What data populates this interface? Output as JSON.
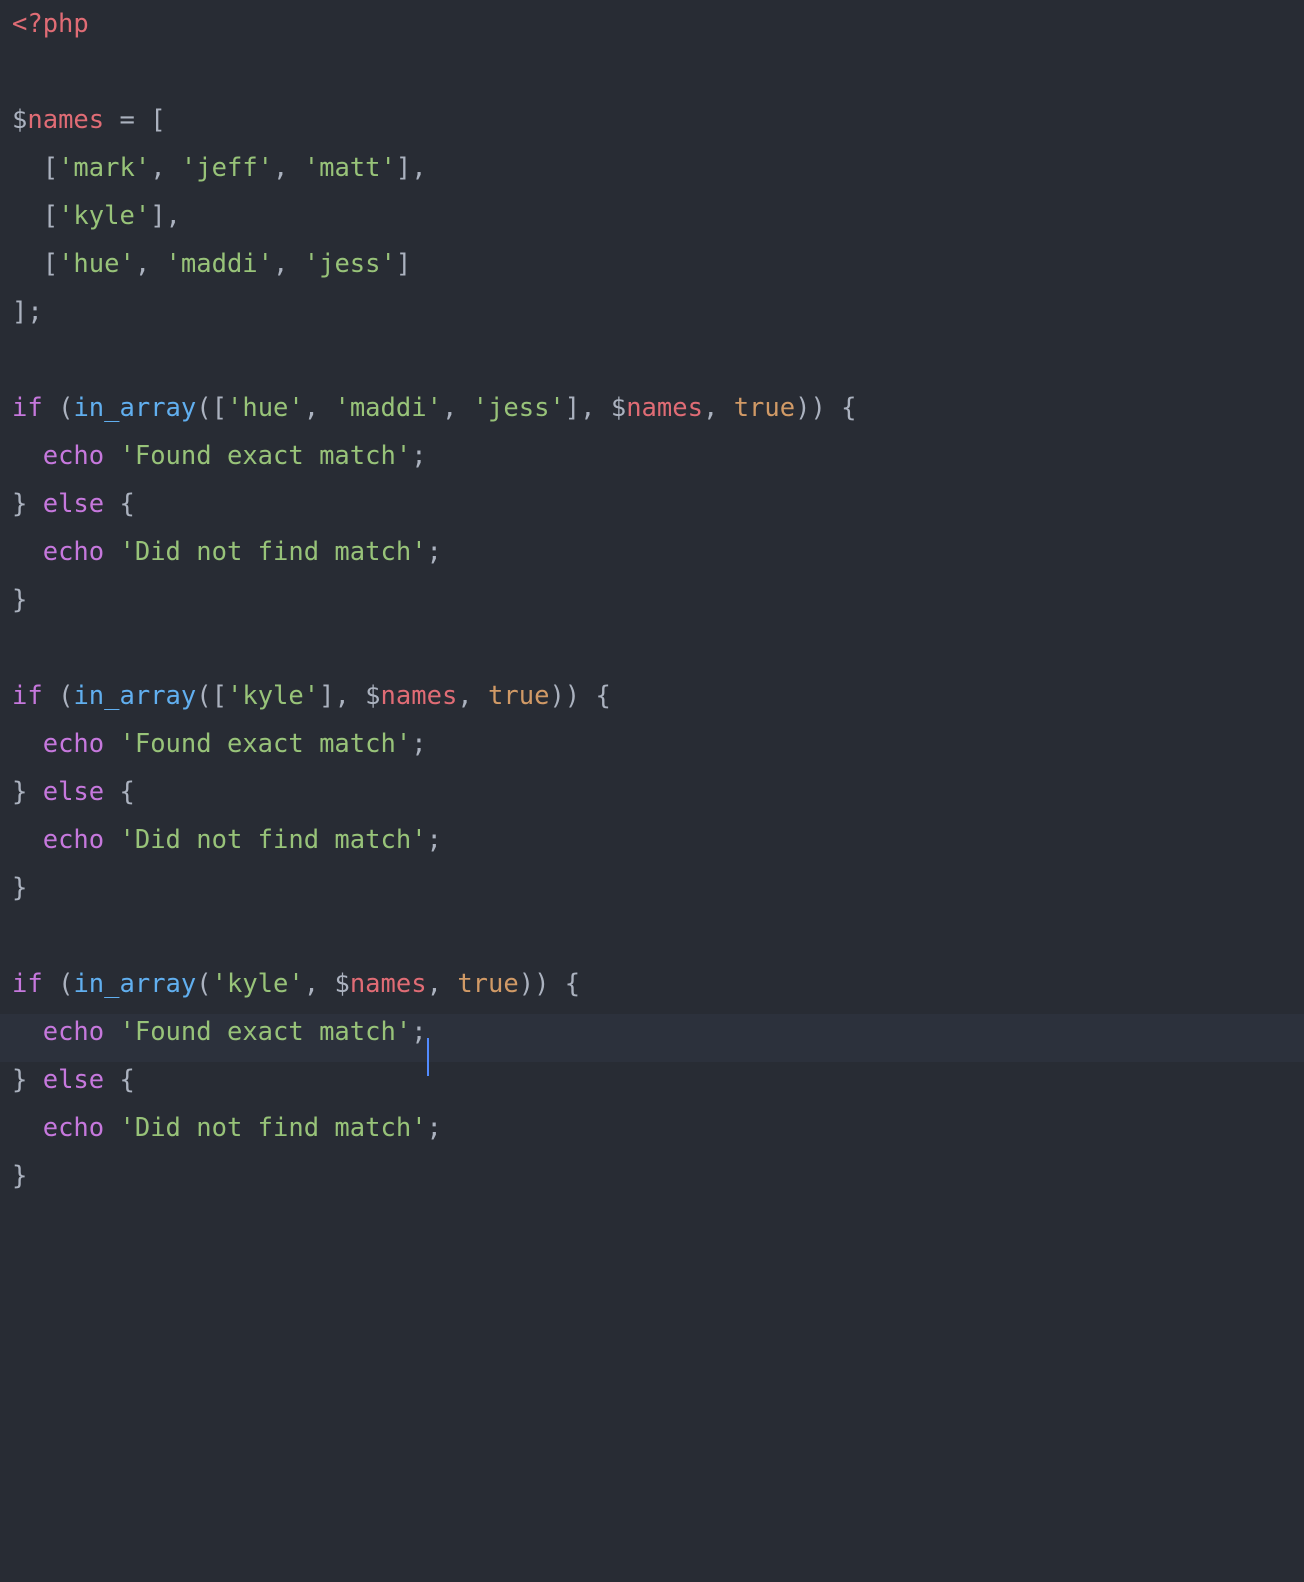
{
  "colors": {
    "background": "#282c34",
    "active_line_bg": "#2c313c",
    "cursor": "#528bff",
    "foreground": "#abb2bf",
    "keyword": "#c678dd",
    "string": "#98c379",
    "variable": "#e06c75",
    "function": "#61afef",
    "constant": "#d19a66",
    "php_tag": "#e06c75"
  },
  "cursor_line_index": 21,
  "tokens": [
    [
      [
        "tk-tag",
        "<?php"
      ]
    ],
    [],
    [
      [
        "tk-varsig",
        "$"
      ],
      [
        "tk-var",
        "names"
      ],
      [
        "tk-punc",
        " "
      ],
      [
        "tk-op",
        "="
      ],
      [
        "tk-punc",
        " ["
      ]
    ],
    [
      [
        "tk-punc",
        "  ["
      ],
      [
        "tk-str",
        "'mark'"
      ],
      [
        "tk-punc",
        ", "
      ],
      [
        "tk-str",
        "'jeff'"
      ],
      [
        "tk-punc",
        ", "
      ],
      [
        "tk-str",
        "'matt'"
      ],
      [
        "tk-punc",
        "],"
      ]
    ],
    [
      [
        "tk-punc",
        "  ["
      ],
      [
        "tk-str",
        "'kyle'"
      ],
      [
        "tk-punc",
        "],"
      ]
    ],
    [
      [
        "tk-punc",
        "  ["
      ],
      [
        "tk-str",
        "'hue'"
      ],
      [
        "tk-punc",
        ", "
      ],
      [
        "tk-str",
        "'maddi'"
      ],
      [
        "tk-punc",
        ", "
      ],
      [
        "tk-str",
        "'jess'"
      ],
      [
        "tk-punc",
        "]"
      ]
    ],
    [
      [
        "tk-punc",
        "];"
      ]
    ],
    [],
    [
      [
        "tk-kw",
        "if"
      ],
      [
        "tk-punc",
        " ("
      ],
      [
        "tk-func",
        "in_array"
      ],
      [
        "tk-punc",
        "(["
      ],
      [
        "tk-str",
        "'hue'"
      ],
      [
        "tk-punc",
        ", "
      ],
      [
        "tk-str",
        "'maddi'"
      ],
      [
        "tk-punc",
        ", "
      ],
      [
        "tk-str",
        "'jess'"
      ],
      [
        "tk-punc",
        "], "
      ],
      [
        "tk-varsig",
        "$"
      ],
      [
        "tk-var",
        "names"
      ],
      [
        "tk-punc",
        ", "
      ],
      [
        "tk-const",
        "true"
      ],
      [
        "tk-punc",
        ")) {"
      ]
    ],
    [
      [
        "tk-punc",
        "  "
      ],
      [
        "tk-echo",
        "echo"
      ],
      [
        "tk-punc",
        " "
      ],
      [
        "tk-str",
        "'Found exact match'"
      ],
      [
        "tk-punc",
        ";"
      ]
    ],
    [
      [
        "tk-punc",
        "} "
      ],
      [
        "tk-kw",
        "else"
      ],
      [
        "tk-punc",
        " {"
      ]
    ],
    [
      [
        "tk-punc",
        "  "
      ],
      [
        "tk-echo",
        "echo"
      ],
      [
        "tk-punc",
        " "
      ],
      [
        "tk-str",
        "'Did not find match'"
      ],
      [
        "tk-punc",
        ";"
      ]
    ],
    [
      [
        "tk-punc",
        "}"
      ]
    ],
    [],
    [
      [
        "tk-kw",
        "if"
      ],
      [
        "tk-punc",
        " ("
      ],
      [
        "tk-func",
        "in_array"
      ],
      [
        "tk-punc",
        "(["
      ],
      [
        "tk-str",
        "'kyle'"
      ],
      [
        "tk-punc",
        "], "
      ],
      [
        "tk-varsig",
        "$"
      ],
      [
        "tk-var",
        "names"
      ],
      [
        "tk-punc",
        ", "
      ],
      [
        "tk-const",
        "true"
      ],
      [
        "tk-punc",
        ")) {"
      ]
    ],
    [
      [
        "tk-punc",
        "  "
      ],
      [
        "tk-echo",
        "echo"
      ],
      [
        "tk-punc",
        " "
      ],
      [
        "tk-str",
        "'Found exact match'"
      ],
      [
        "tk-punc",
        ";"
      ]
    ],
    [
      [
        "tk-punc",
        "} "
      ],
      [
        "tk-kw",
        "else"
      ],
      [
        "tk-punc",
        " {"
      ]
    ],
    [
      [
        "tk-punc",
        "  "
      ],
      [
        "tk-echo",
        "echo"
      ],
      [
        "tk-punc",
        " "
      ],
      [
        "tk-str",
        "'Did not find match'"
      ],
      [
        "tk-punc",
        ";"
      ]
    ],
    [
      [
        "tk-punc",
        "}"
      ]
    ],
    [],
    [
      [
        "tk-kw",
        "if"
      ],
      [
        "tk-punc",
        " ("
      ],
      [
        "tk-func",
        "in_array"
      ],
      [
        "tk-punc",
        "("
      ],
      [
        "tk-str",
        "'kyle'"
      ],
      [
        "tk-punc",
        ", "
      ],
      [
        "tk-varsig",
        "$"
      ],
      [
        "tk-var",
        "names"
      ],
      [
        "tk-punc",
        ", "
      ],
      [
        "tk-const",
        "true"
      ],
      [
        "tk-punc",
        ")) {"
      ]
    ],
    [
      [
        "tk-punc",
        "  "
      ],
      [
        "tk-echo",
        "echo"
      ],
      [
        "tk-punc",
        " "
      ],
      [
        "tk-str",
        "'Found exact match'"
      ],
      [
        "tk-punc",
        ";"
      ],
      [
        "__CURSOR__",
        ""
      ]
    ],
    [
      [
        "tk-punc",
        "} "
      ],
      [
        "tk-kw",
        "else"
      ],
      [
        "tk-punc",
        " {"
      ]
    ],
    [
      [
        "tk-punc",
        "  "
      ],
      [
        "tk-echo",
        "echo"
      ],
      [
        "tk-punc",
        " "
      ],
      [
        "tk-str",
        "'Did not find match'"
      ],
      [
        "tk-punc",
        ";"
      ]
    ],
    [
      [
        "tk-punc",
        "}"
      ]
    ]
  ],
  "code_lines": [
    "<?php",
    "",
    "$names = [",
    "  ['mark', 'jeff', 'matt'],",
    "  ['kyle'],",
    "  ['hue', 'maddi', 'jess']",
    "];",
    "",
    "if (in_array(['hue', 'maddi', 'jess'], $names, true)) {",
    "  echo 'Found exact match';",
    "} else {",
    "  echo 'Did not find match';",
    "}",
    "",
    "if (in_array(['kyle'], $names, true)) {",
    "  echo 'Found exact match';",
    "} else {",
    "  echo 'Did not find match';",
    "}",
    "",
    "if (in_array('kyle', $names, true)) {",
    "  echo 'Found exact match';",
    "} else {",
    "  echo 'Did not find match';",
    "}"
  ]
}
